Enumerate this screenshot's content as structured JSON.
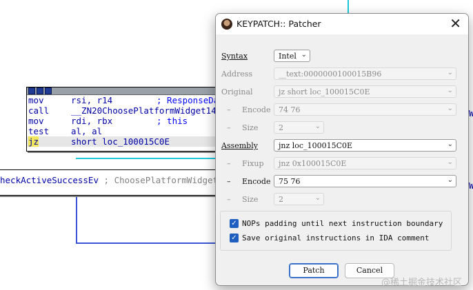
{
  "ida": {
    "block1": {
      "rows": [
        {
          "mnemonic": "mov",
          "operands": "rsi, r14",
          "comment": "; ResponseDa"
        },
        {
          "mnemonic": "call",
          "operands": "__ZN20ChoosePlatformWidget14",
          "comment": ""
        },
        {
          "mnemonic": "mov",
          "operands": "rdi, rbx",
          "comment": "; this"
        },
        {
          "mnemonic": "test",
          "operands": "al, al",
          "comment": ""
        },
        {
          "mnemonic": "jz",
          "operands": "short loc_100015C0E",
          "comment": ""
        }
      ]
    },
    "block2": {
      "text_a": "heckActiveSuccessEv",
      "text_b": " ; ChoosePlatformWidget"
    },
    "right_fragments": [
      "W",
      "W"
    ]
  },
  "dialog": {
    "title": "KEYPATCH:: Patcher",
    "close_glyph": "✕",
    "syntax": {
      "label": "Syntax",
      "value": "Intel"
    },
    "address": {
      "label": "Address",
      "value": "__text:0000000100015B96"
    },
    "original": {
      "label": "Original",
      "value": "jz short loc_100015C0E"
    },
    "orig_encode": {
      "label": "Encode",
      "value": "74 76"
    },
    "orig_size": {
      "label": "Size",
      "value": "2"
    },
    "assembly": {
      "label": "Assembly",
      "value": "jnz loc_100015C0E"
    },
    "fixup": {
      "label": "Fixup",
      "value": "jnz 0x100015C0E"
    },
    "encode": {
      "label": "Encode",
      "value": "75 76"
    },
    "size": {
      "label": "Size",
      "value": "2"
    },
    "dash": "–",
    "options": {
      "nops_label": "NOPs padding until next instruction boundary",
      "save_label": "Save original instructions in IDA comment"
    },
    "buttons": {
      "patch": "Patch",
      "cancel": "Cancel"
    }
  },
  "watermark": "@稀土掘金技术社区",
  "colors": {
    "accent": "#3a6fc9",
    "graph_edge": "#3a56d6",
    "jz_highlight": "#f2e65a"
  }
}
